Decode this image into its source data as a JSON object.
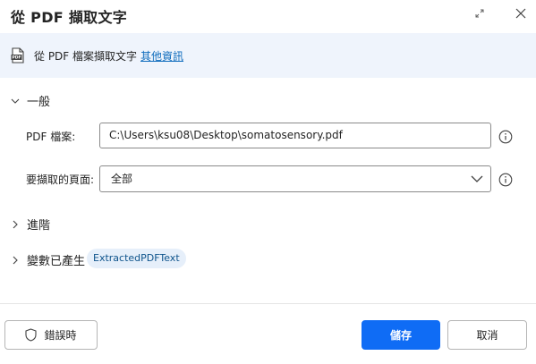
{
  "dialog": {
    "title": "從 PDF 擷取文字"
  },
  "info": {
    "description": "從 PDF 檔案擷取文字",
    "more_info_link": "其他資訊"
  },
  "sections": {
    "general": "一般",
    "advanced": "進階",
    "variables": "變數已產生"
  },
  "fields": {
    "pdf_file_label": "PDF 檔案:",
    "pdf_file_value": "C:\\Users\\ksu08\\Desktop\\somatosensory.pdf",
    "pages_label": "要擷取的頁面:",
    "pages_value": "全部"
  },
  "variables": {
    "produced": "ExtractedPDFText"
  },
  "footer": {
    "on_error_label": "錯誤時",
    "save_label": "儲存",
    "cancel_label": "取消"
  },
  "colors": {
    "accent": "#0f6cf5",
    "link": "#0f6cbd",
    "info_bar_bg": "#eff4fc",
    "chip_bg": "#e6effa"
  },
  "icons": [
    "pdf-file-icon",
    "expand-icon",
    "close-icon",
    "chevron-down-icon",
    "chevron-right-icon",
    "info-icon",
    "shield-icon"
  ]
}
